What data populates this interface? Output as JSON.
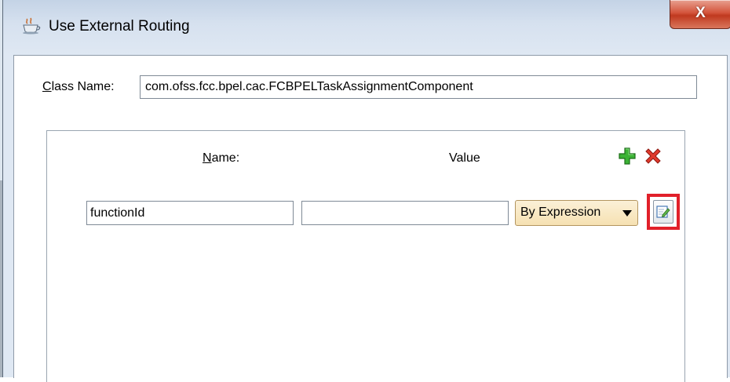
{
  "window": {
    "title": "Use External Routing",
    "close_glyph": "X",
    "icon": "java-cup-icon"
  },
  "form": {
    "class_label_prefix": "C",
    "class_label_rest": "lass Name:",
    "class_value": "com.ofss.fcc.bpel.cac.FCBPELTaskAssignmentComponent"
  },
  "params": {
    "name_header_prefix": "N",
    "name_header_rest": "ame:",
    "value_header": "Value",
    "add_icon": "add-icon",
    "remove_icon": "remove-icon",
    "rows": [
      {
        "name": "functionId",
        "value": "",
        "mode": "By Expression"
      }
    ],
    "edit_icon": "edit-expression-icon"
  },
  "colors": {
    "highlight": "#e1202a",
    "add_green": "#2fa12a",
    "remove_red": "#d8261c",
    "select_fill": "#f6e1b2"
  }
}
